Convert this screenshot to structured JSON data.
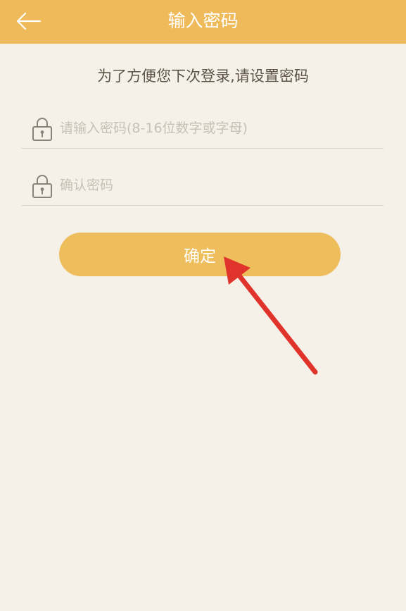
{
  "header": {
    "title": "输入密码",
    "back_icon": "arrow-left-icon"
  },
  "subtitle": "为了方便您下次登录,请设置密码",
  "form": {
    "password": {
      "placeholder": "请输入密码(8-16位数字或字母)",
      "value": "",
      "icon": "lock-icon"
    },
    "confirm_password": {
      "placeholder": "确认密码",
      "value": "",
      "icon": "lock-icon"
    },
    "submit_label": "确定"
  },
  "colors": {
    "header_bg": "#efbb5a",
    "page_bg": "#f5f1e9",
    "button_bg": "#eebd5c",
    "annotation_arrow": "#e0332c"
  }
}
